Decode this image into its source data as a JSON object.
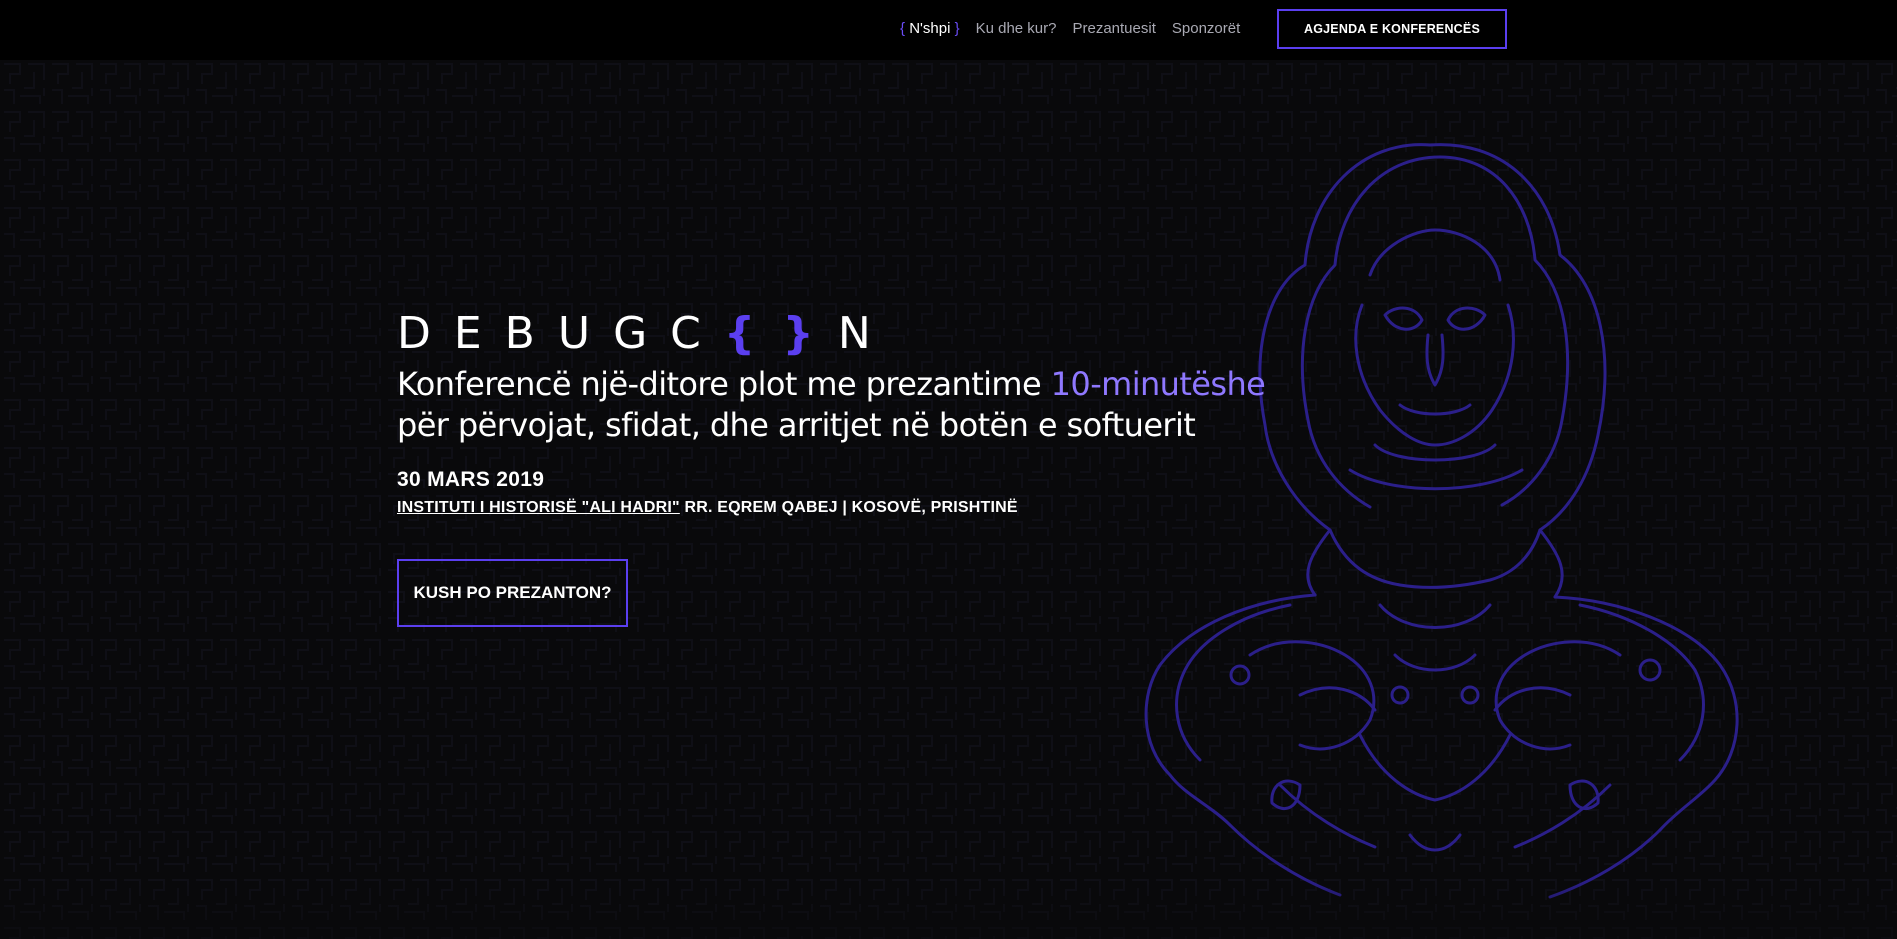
{
  "nav": {
    "items": [
      {
        "open_brace": "{",
        "label": "N'shpi",
        "close_brace": "}"
      },
      {
        "label": "Ku dhe kur?"
      },
      {
        "label": "Prezantuesit"
      },
      {
        "label": "Sponzorët"
      }
    ],
    "cta_label": "AGJENDA E KONFERENCËS"
  },
  "hero": {
    "logo_prefix": "DEBUGC",
    "logo_braces": "{ }",
    "logo_suffix": "N",
    "tagline_before": "Konferencë një-ditore plot me prezantime ",
    "tagline_accent": "10-minutëshe",
    "tagline_after": "për përvojat, sfidat, dhe arritjet në botën e softuerit",
    "date": "30 MARS 2019",
    "venue": "INSTITUTI I HISTORISË \"ALI HADRI\"",
    "address": " RR. EQREM QABEJ | KOSOVË, PRISHTINË",
    "cta_label": "KUSH PO PREZANTON?"
  },
  "colors": {
    "background": "#09090b",
    "accent": "#5b3ff0",
    "accent_text": "#8f78ff",
    "nav_text": "#a9a9b3"
  },
  "icons": {
    "illustration": "line-art-figure-illustration",
    "background": "maze-pattern"
  }
}
